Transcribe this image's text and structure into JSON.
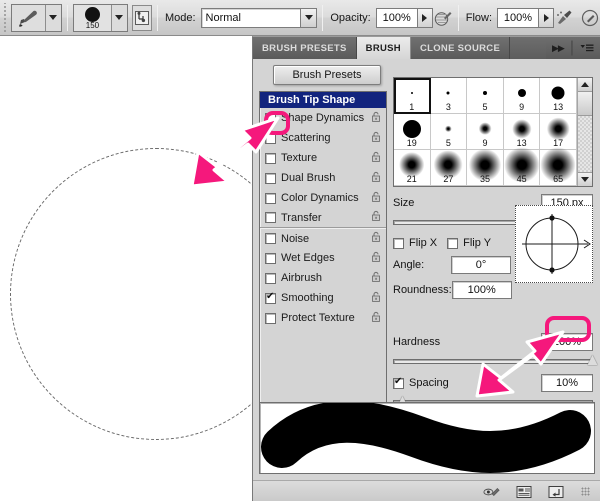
{
  "options_bar": {
    "tool_icon": "paintbrush-icon",
    "tool_dropdown_icon": "chevron-down-icon",
    "brush_preset_size": "150",
    "brush_preset_dropdown_icon": "chevron-down-icon",
    "toggle_panel_icon": "toggle-brush-panel-icon",
    "mode_label": "Mode:",
    "mode_value": "Normal",
    "mode_dropdown_icon": "chevron-down-icon",
    "opacity_label": "Opacity:",
    "opacity_value": "100%",
    "opacity_stepper_icon": "chevron-right-icon",
    "opacity_pressure_icon": "pressure-opacity-icon",
    "flow_label": "Flow:",
    "flow_value": "100%",
    "flow_stepper_icon": "chevron-right-icon",
    "airbrush_icon": "airbrush-icon",
    "pressure_size_icon": "pressure-size-icon"
  },
  "canvas": {
    "brush_cursor_shape": "circle-outline"
  },
  "panel": {
    "tabs": [
      {
        "label": "BRUSH PRESETS",
        "active": false
      },
      {
        "label": "BRUSH",
        "active": true
      },
      {
        "label": "CLONE SOURCE",
        "active": false
      }
    ],
    "collapse_icon": "double-chevron-right-icon",
    "menu_icon": "panel-menu-icon",
    "presets_button_label": "Brush Presets",
    "list_header": "Brush Tip Shape",
    "options": [
      {
        "label": "Shape Dynamics",
        "checked": false,
        "lock": "unlocked"
      },
      {
        "label": "Scattering",
        "checked": false,
        "lock": "unlocked"
      },
      {
        "label": "Texture",
        "checked": false,
        "lock": "unlocked"
      },
      {
        "label": "Dual Brush",
        "checked": false,
        "lock": "unlocked"
      },
      {
        "label": "Color Dynamics",
        "checked": false,
        "lock": "unlocked"
      },
      {
        "label": "Transfer",
        "checked": false,
        "lock": "unlocked"
      },
      {
        "label": "Noise",
        "checked": false,
        "lock": "unlocked"
      },
      {
        "label": "Wet Edges",
        "checked": false,
        "lock": "unlocked"
      },
      {
        "label": "Airbrush",
        "checked": false,
        "lock": "unlocked"
      },
      {
        "label": "Smoothing",
        "checked": true,
        "lock": "unlocked"
      },
      {
        "label": "Protect Texture",
        "checked": false,
        "lock": "unlocked"
      }
    ],
    "brush_grid": [
      {
        "size": "1",
        "dot": 2,
        "soft": false,
        "selected": true
      },
      {
        "size": "3",
        "dot": 3,
        "soft": false,
        "selected": false
      },
      {
        "size": "5",
        "dot": 4,
        "soft": false,
        "selected": false
      },
      {
        "size": "9",
        "dot": 8,
        "soft": false,
        "selected": false
      },
      {
        "size": "13",
        "dot": 13,
        "soft": false,
        "selected": false
      },
      {
        "size": "19",
        "dot": 18,
        "soft": false,
        "selected": false
      },
      {
        "size": "5",
        "dot": 4,
        "soft": true,
        "selected": false
      },
      {
        "size": "9",
        "dot": 8,
        "soft": true,
        "selected": false
      },
      {
        "size": "13",
        "dot": 12,
        "soft": true,
        "selected": false
      },
      {
        "size": "17",
        "dot": 14,
        "soft": true,
        "selected": false
      },
      {
        "size": "21",
        "dot": 16,
        "soft": true,
        "selected": false
      },
      {
        "size": "27",
        "dot": 18,
        "soft": true,
        "selected": false
      },
      {
        "size": "35",
        "dot": 20,
        "soft": true,
        "selected": false
      },
      {
        "size": "45",
        "dot": 22,
        "soft": true,
        "selected": false
      },
      {
        "size": "65",
        "dot": 22,
        "soft": true,
        "selected": false
      }
    ],
    "scroll_up_icon": "caret-up-icon",
    "scroll_down_icon": "caret-down-icon",
    "size_label": "Size",
    "size_value": "150 px",
    "size_slider_percent": 80,
    "flip_x_label": "Flip X",
    "flip_x_checked": false,
    "flip_y_label": "Flip Y",
    "flip_y_checked": false,
    "angle_label": "Angle:",
    "angle_value": "0°",
    "roundness_label": "Roundness:",
    "roundness_value": "100%",
    "hardness_label": "Hardness",
    "hardness_value": "100%",
    "hardness_slider_percent": 100,
    "spacing_label": "Spacing",
    "spacing_checked": true,
    "spacing_value": "10%",
    "spacing_slider_percent": 5,
    "footer_icons": [
      "toggle-brush-preview-icon",
      "open-preset-manager-icon",
      "create-new-brush-icon"
    ],
    "resize_grip_icon": "resize-grip-icon"
  },
  "annotations": {
    "arrow_color": "#f5187c",
    "callouts": [
      {
        "target": "shape-dynamics-checkbox",
        "arrow": "arrow-up-right-icon"
      },
      {
        "target": "spacing-value-field",
        "arrow": "arrow-up-right-icon"
      }
    ]
  }
}
